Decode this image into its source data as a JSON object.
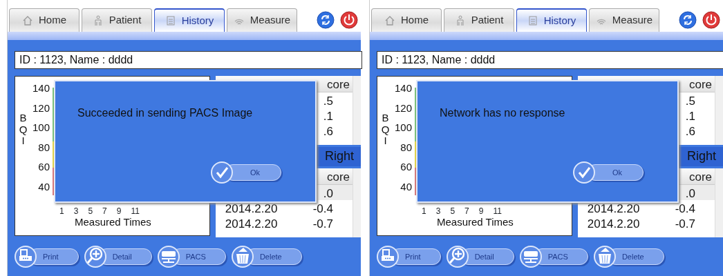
{
  "panels": [
    {
      "tabs": [
        {
          "label": "Home",
          "selected": false
        },
        {
          "label": "Patient",
          "selected": false
        },
        {
          "label": "History",
          "selected": true
        },
        {
          "label": "Measure",
          "selected": false
        }
      ],
      "patient_field": {
        "value": "ID : 1123, Name : dddd"
      },
      "chart": {
        "ylabel": "BQI",
        "y_ticks": [
          "140",
          "120",
          "100",
          "80",
          "60",
          "40"
        ],
        "x_ticks": [
          "1",
          "3",
          "5",
          "7",
          "9",
          "11"
        ],
        "xlabel": "Measured Times"
      },
      "upper_table": {
        "header": "core",
        "cells": [
          ".5",
          ".1",
          ".6"
        ]
      },
      "section_label": "Right",
      "lower_table": {
        "header": "core",
        "rows": [
          {
            "score": ".0",
            "selected": true
          },
          {
            "date": "2014.2.20",
            "score": "-0.4",
            "selected": false
          },
          {
            "date": "2014.2.20",
            "score": "-0.7",
            "selected": false
          }
        ]
      },
      "dialog": {
        "message": "Succeeded in sending PACS Image",
        "button": "Ok"
      },
      "buttons": [
        {
          "label": "Print"
        },
        {
          "label": "Detail"
        },
        {
          "label": "PACS"
        },
        {
          "label": "Delete"
        }
      ]
    },
    {
      "tabs": [
        {
          "label": "Home",
          "selected": false
        },
        {
          "label": "Patient",
          "selected": false
        },
        {
          "label": "History",
          "selected": true
        },
        {
          "label": "Measure",
          "selected": false
        }
      ],
      "patient_field": {
        "value": "ID : 1123, Name : dddd"
      },
      "chart": {
        "ylabel": "BQI",
        "y_ticks": [
          "140",
          "120",
          "100",
          "80",
          "60",
          "40"
        ],
        "x_ticks": [
          "1",
          "3",
          "5",
          "7",
          "9",
          "11"
        ],
        "xlabel": "Measured Times"
      },
      "upper_table": {
        "header": "core",
        "cells": [
          ".5",
          ".1",
          ".6"
        ]
      },
      "section_label": "Right",
      "lower_table": {
        "header": "core",
        "rows": [
          {
            "score": ".0",
            "selected": true
          },
          {
            "date": "2014.2.20",
            "score": "-0.4",
            "selected": false
          },
          {
            "date": "2014.2.20",
            "score": "-0.7",
            "selected": false
          }
        ]
      },
      "dialog": {
        "message": "Network has no response",
        "button": "Ok"
      },
      "buttons": [
        {
          "label": "Print"
        },
        {
          "label": "Detail"
        },
        {
          "label": "PACS"
        },
        {
          "label": "Delete"
        }
      ]
    }
  ]
}
